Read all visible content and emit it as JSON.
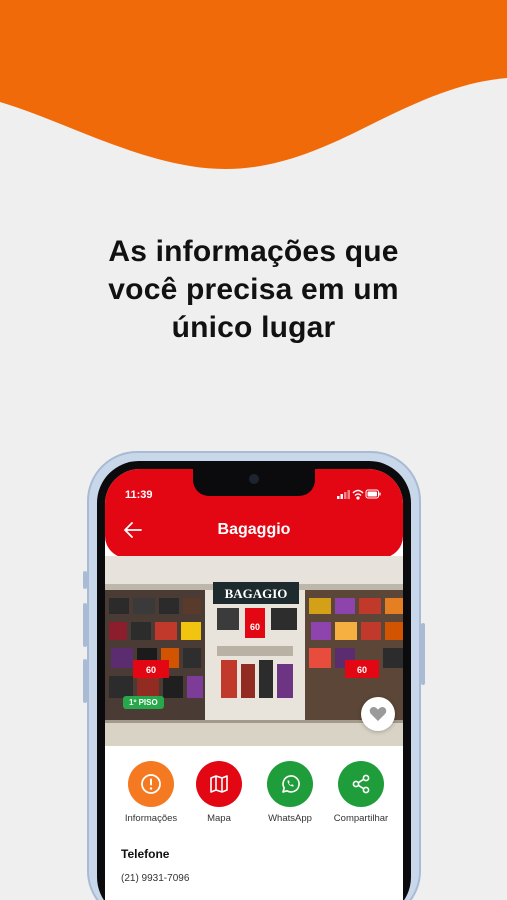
{
  "colors": {
    "brand_orange": "#f06a0a",
    "page_background": "#efefef",
    "header_red": "#e30613",
    "info_orange": "#f47920",
    "map_red": "#e30613",
    "whatsapp_green": "#1f9d3a",
    "share_green": "#1f9d3a",
    "floor_badge_green": "#27a84a"
  },
  "headline": {
    "line1": "As informações que",
    "line2": "você precisa em um",
    "line3": "único lugar"
  },
  "status_bar": {
    "time": "11:39",
    "icons": [
      "signal-icon",
      "wifi-icon",
      "battery-icon"
    ]
  },
  "store": {
    "title": "Bagaggio",
    "sign_text": "BAGAGIO",
    "floor_badge": "1º PISO",
    "photo_tags": [
      "60",
      "60",
      "60"
    ]
  },
  "actions": [
    {
      "label": "Informações",
      "icon": "info-icon"
    },
    {
      "label": "Mapa",
      "icon": "map-icon"
    },
    {
      "label": "WhatsApp",
      "icon": "whatsapp-icon"
    },
    {
      "label": "Compartilhar",
      "icon": "share-icon"
    }
  ],
  "contact": {
    "phone_label": "Telefone",
    "phone_value": "(21) 9931-7096"
  }
}
